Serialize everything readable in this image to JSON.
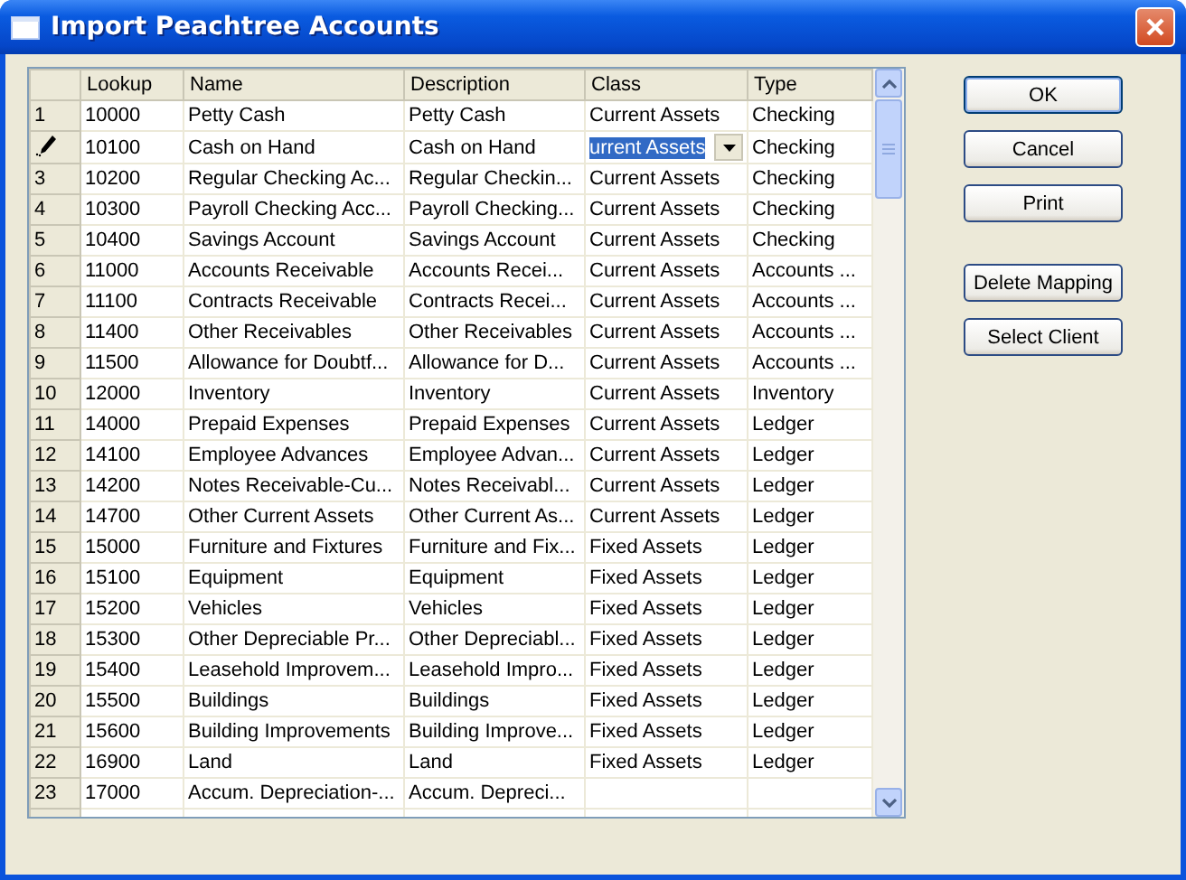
{
  "window": {
    "title": "Import Peachtree Accounts"
  },
  "table": {
    "columns": [
      "Lookup",
      "Name",
      "Description",
      "Class",
      "Type"
    ],
    "rows": [
      {
        "header": "1",
        "editing": false,
        "lookup": "10000",
        "name": "Petty Cash",
        "description": "Petty Cash",
        "class": "Current Assets",
        "type": "Checking"
      },
      {
        "editing": true,
        "lookup": "10100",
        "name": "Cash on Hand",
        "description": "Cash on Hand",
        "class": "urrent Assets",
        "type": "Checking"
      },
      {
        "header": "3",
        "editing": false,
        "lookup": "10200",
        "name": "Regular Checking Ac...",
        "description": "Regular Checkin...",
        "class": "Current Assets",
        "type": "Checking"
      },
      {
        "header": "4",
        "editing": false,
        "lookup": "10300",
        "name": "Payroll Checking Acc...",
        "description": "Payroll Checking...",
        "class": "Current Assets",
        "type": "Checking"
      },
      {
        "header": "5",
        "editing": false,
        "lookup": "10400",
        "name": "Savings Account",
        "description": "Savings Account",
        "class": "Current Assets",
        "type": "Checking"
      },
      {
        "header": "6",
        "editing": false,
        "lookup": "11000",
        "name": "Accounts Receivable",
        "description": "Accounts Recei...",
        "class": "Current Assets",
        "type": "Accounts ..."
      },
      {
        "header": "7",
        "editing": false,
        "lookup": "11100",
        "name": "Contracts Receivable",
        "description": "Contracts Recei...",
        "class": "Current Assets",
        "type": "Accounts ..."
      },
      {
        "header": "8",
        "editing": false,
        "lookup": "11400",
        "name": "Other Receivables",
        "description": "Other Receivables",
        "class": "Current Assets",
        "type": "Accounts ..."
      },
      {
        "header": "9",
        "editing": false,
        "lookup": "11500",
        "name": "Allowance for Doubtf...",
        "description": "Allowance for D...",
        "class": "Current Assets",
        "type": "Accounts ..."
      },
      {
        "header": "10",
        "editing": false,
        "lookup": "12000",
        "name": "Inventory",
        "description": "Inventory",
        "class": "Current Assets",
        "type": "Inventory"
      },
      {
        "header": "11",
        "editing": false,
        "lookup": "14000",
        "name": "Prepaid Expenses",
        "description": "Prepaid Expenses",
        "class": "Current Assets",
        "type": "Ledger"
      },
      {
        "header": "12",
        "editing": false,
        "lookup": "14100",
        "name": "Employee Advances",
        "description": "Employee Advan...",
        "class": "Current Assets",
        "type": "Ledger"
      },
      {
        "header": "13",
        "editing": false,
        "lookup": "14200",
        "name": "Notes Receivable-Cu...",
        "description": "Notes Receivabl...",
        "class": "Current Assets",
        "type": "Ledger"
      },
      {
        "header": "14",
        "editing": false,
        "lookup": "14700",
        "name": "Other Current Assets",
        "description": "Other Current As...",
        "class": "Current Assets",
        "type": "Ledger"
      },
      {
        "header": "15",
        "editing": false,
        "lookup": "15000",
        "name": "Furniture and Fixtures",
        "description": "Furniture and Fix...",
        "class": "Fixed Assets",
        "type": "Ledger"
      },
      {
        "header": "16",
        "editing": false,
        "lookup": "15100",
        "name": "Equipment",
        "description": "Equipment",
        "class": "Fixed Assets",
        "type": "Ledger"
      },
      {
        "header": "17",
        "editing": false,
        "lookup": "15200",
        "name": "Vehicles",
        "description": "Vehicles",
        "class": "Fixed Assets",
        "type": "Ledger"
      },
      {
        "header": "18",
        "editing": false,
        "lookup": "15300",
        "name": "Other Depreciable Pr...",
        "description": "Other Depreciabl...",
        "class": "Fixed Assets",
        "type": "Ledger"
      },
      {
        "header": "19",
        "editing": false,
        "lookup": "15400",
        "name": "Leasehold Improvem...",
        "description": "Leasehold Impro...",
        "class": "Fixed Assets",
        "type": "Ledger"
      },
      {
        "header": "20",
        "editing": false,
        "lookup": "15500",
        "name": "Buildings",
        "description": "Buildings",
        "class": "Fixed Assets",
        "type": "Ledger"
      },
      {
        "header": "21",
        "editing": false,
        "lookup": "15600",
        "name": "Building Improvements",
        "description": "Building Improve...",
        "class": "Fixed Assets",
        "type": "Ledger"
      },
      {
        "header": "22",
        "editing": false,
        "lookup": "16900",
        "name": "Land",
        "description": "Land",
        "class": "Fixed Assets",
        "type": "Ledger"
      },
      {
        "header": "23",
        "editing": false,
        "lookup": "17000",
        "name": "Accum. Depreciation-...",
        "description": "Accum. Depreci..."
      }
    ]
  },
  "buttons": [
    {
      "label": "OK",
      "default": true
    },
    {
      "label": "Cancel",
      "default": false
    },
    {
      "label": "Print",
      "default": false
    }
  ],
  "mapping_buttons": [
    {
      "label": "Delete Mapping",
      "default": false
    },
    {
      "label": "Select Client",
      "default": false
    }
  ]
}
